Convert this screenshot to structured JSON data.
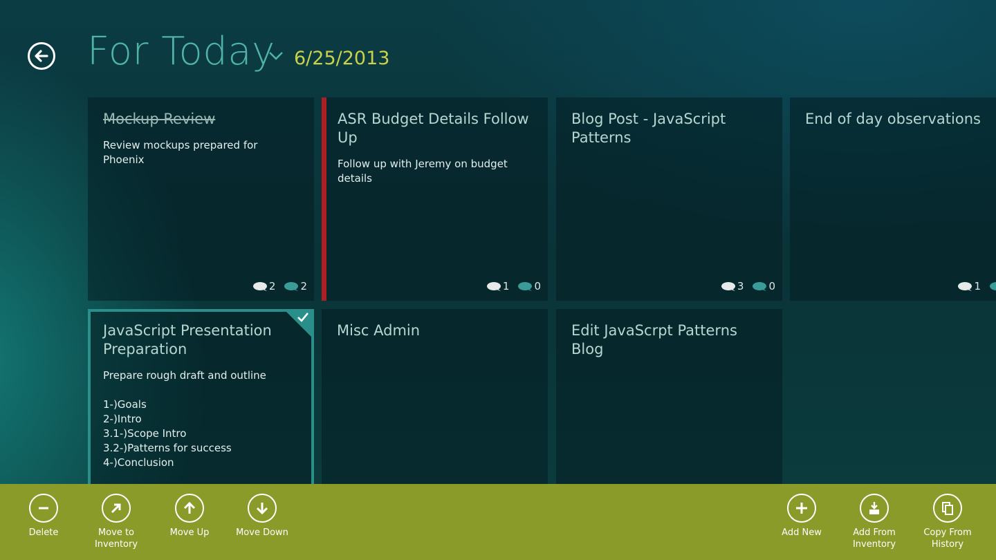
{
  "header": {
    "title": "For Today",
    "date": "6/25/2013"
  },
  "tiles": [
    {
      "title": "Mockup Review",
      "description": "Review mockups prepared for Phoenix",
      "count_a": "2",
      "count_b": "2"
    },
    {
      "title": "ASR Budget Details Follow Up",
      "description": "Follow up with Jeremy on budget details",
      "count_a": "1",
      "count_b": "0"
    },
    {
      "title": "Blog Post - JavaScript Patterns",
      "description": "",
      "count_a": "3",
      "count_b": "0"
    },
    {
      "title": "End of day observations",
      "description": "",
      "count_a": "1",
      "count_b": ""
    },
    {
      "title": "JavaScript Presentation Preparation",
      "description": "Prepare rough draft and outline\n\n1-)Goals\n2-)Intro\n3.1-)Scope Intro\n3.2-)Patterns for success\n4-)Conclusion"
    },
    {
      "title": "Misc Admin"
    },
    {
      "title": "Edit JavaScrpt Patterns Blog"
    }
  ],
  "appbar": {
    "delete": "Delete",
    "move_to_inventory": "Move to\nInventory",
    "move_up": "Move Up",
    "move_down": "Move Down",
    "add_new": "Add New",
    "add_from_inventory": "Add From\nInventory",
    "copy_from_history": "Copy From\nHistory"
  },
  "colors": {
    "title": "#4fb3a6",
    "date": "#c9d24a",
    "appbar": "#8b9b2a",
    "flag": "#b01e23",
    "selection": "#2a8f8a"
  },
  "icons": {
    "back": "back-arrow-icon",
    "chevron": "chevron-down-icon",
    "comment": "comment-bubble-icon",
    "check": "check-icon"
  }
}
